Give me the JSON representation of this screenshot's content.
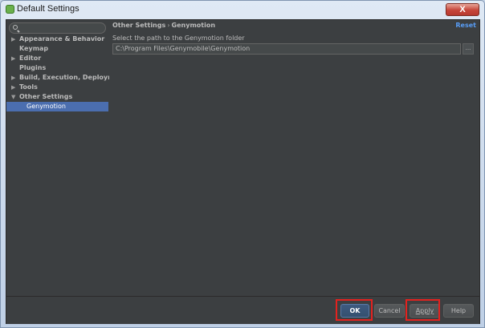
{
  "window": {
    "title": "Default Settings",
    "close_symbol": "X"
  },
  "search": {
    "placeholder": ""
  },
  "sidebar": {
    "items": [
      {
        "label": "Appearance & Behavior",
        "arrow": "▶"
      },
      {
        "label": "Keymap",
        "arrow": ""
      },
      {
        "label": "Editor",
        "arrow": "▶"
      },
      {
        "label": "Plugins",
        "arrow": ""
      },
      {
        "label": "Build, Execution, Deployment",
        "arrow": "▶"
      },
      {
        "label": "Tools",
        "arrow": "▶"
      },
      {
        "label": "Other Settings",
        "arrow": "▼"
      },
      {
        "label": "Genymotion",
        "arrow": ""
      }
    ]
  },
  "main": {
    "breadcrumb_parent": "Other Settings",
    "breadcrumb_sep": "›",
    "breadcrumb_current": "Genymotion",
    "reset_label": "Reset",
    "hint": "Select the path to the Genymotion folder",
    "path_value": "C:\\Program Files\\Genymobile\\Genymotion",
    "browse_label": "..."
  },
  "footer": {
    "ok": "OK",
    "cancel": "Cancel",
    "apply": "Apply",
    "help": "Help"
  },
  "colors": {
    "panel_bg": "#3c3f41",
    "selection": "#4b6eaf",
    "link": "#589df6",
    "highlight": "#e3221f"
  }
}
